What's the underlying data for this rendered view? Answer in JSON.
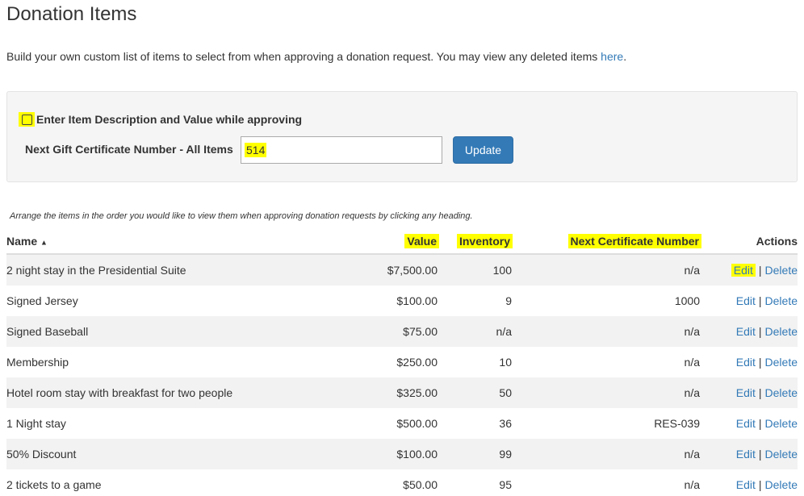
{
  "page": {
    "title": "Donation Items",
    "intro_text": "Build your own custom list of items to select from when approving a donation request. You may view any deleted items ",
    "intro_link": "here",
    "intro_end": "."
  },
  "settings": {
    "checkbox_label": "Enter Item Description and Value while approving",
    "checkbox_checked": false,
    "gift_label": "Next Gift Certificate Number - All Items",
    "gift_value": "514",
    "update_label": "Update"
  },
  "table": {
    "hint": "Arrange the items in the order you would like to view them when approving donation requests by clicking any heading.",
    "headers": {
      "name": "Name",
      "value": "Value",
      "inventory": "Inventory",
      "next_cert": "Next Certificate Number",
      "actions": "Actions"
    },
    "sort_indicator": "▲",
    "edit_label": "Edit",
    "delete_label": "Delete",
    "separator": "|",
    "rows": [
      {
        "name": "2 night stay in the Presidential Suite",
        "value": "$7,500.00",
        "inventory": "100",
        "next_cert": "n/a"
      },
      {
        "name": "Signed Jersey",
        "value": "$100.00",
        "inventory": "9",
        "next_cert": "1000"
      },
      {
        "name": "Signed Baseball",
        "value": "$75.00",
        "inventory": "n/a",
        "next_cert": "n/a"
      },
      {
        "name": "Membership",
        "value": "$250.00",
        "inventory": "10",
        "next_cert": "n/a"
      },
      {
        "name": "Hotel room stay with breakfast for two people",
        "value": "$325.00",
        "inventory": "50",
        "next_cert": "n/a"
      },
      {
        "name": "1 Night stay",
        "value": "$500.00",
        "inventory": "36",
        "next_cert": "RES-039"
      },
      {
        "name": "50% Discount",
        "value": "$100.00",
        "inventory": "99",
        "next_cert": "n/a"
      },
      {
        "name": "2 tickets to a game",
        "value": "$50.00",
        "inventory": "95",
        "next_cert": "n/a"
      }
    ]
  },
  "colors": {
    "highlight": "#ffff00",
    "link": "#337ab7",
    "button": "#337ab7",
    "stripe": "#f2f2f2"
  }
}
